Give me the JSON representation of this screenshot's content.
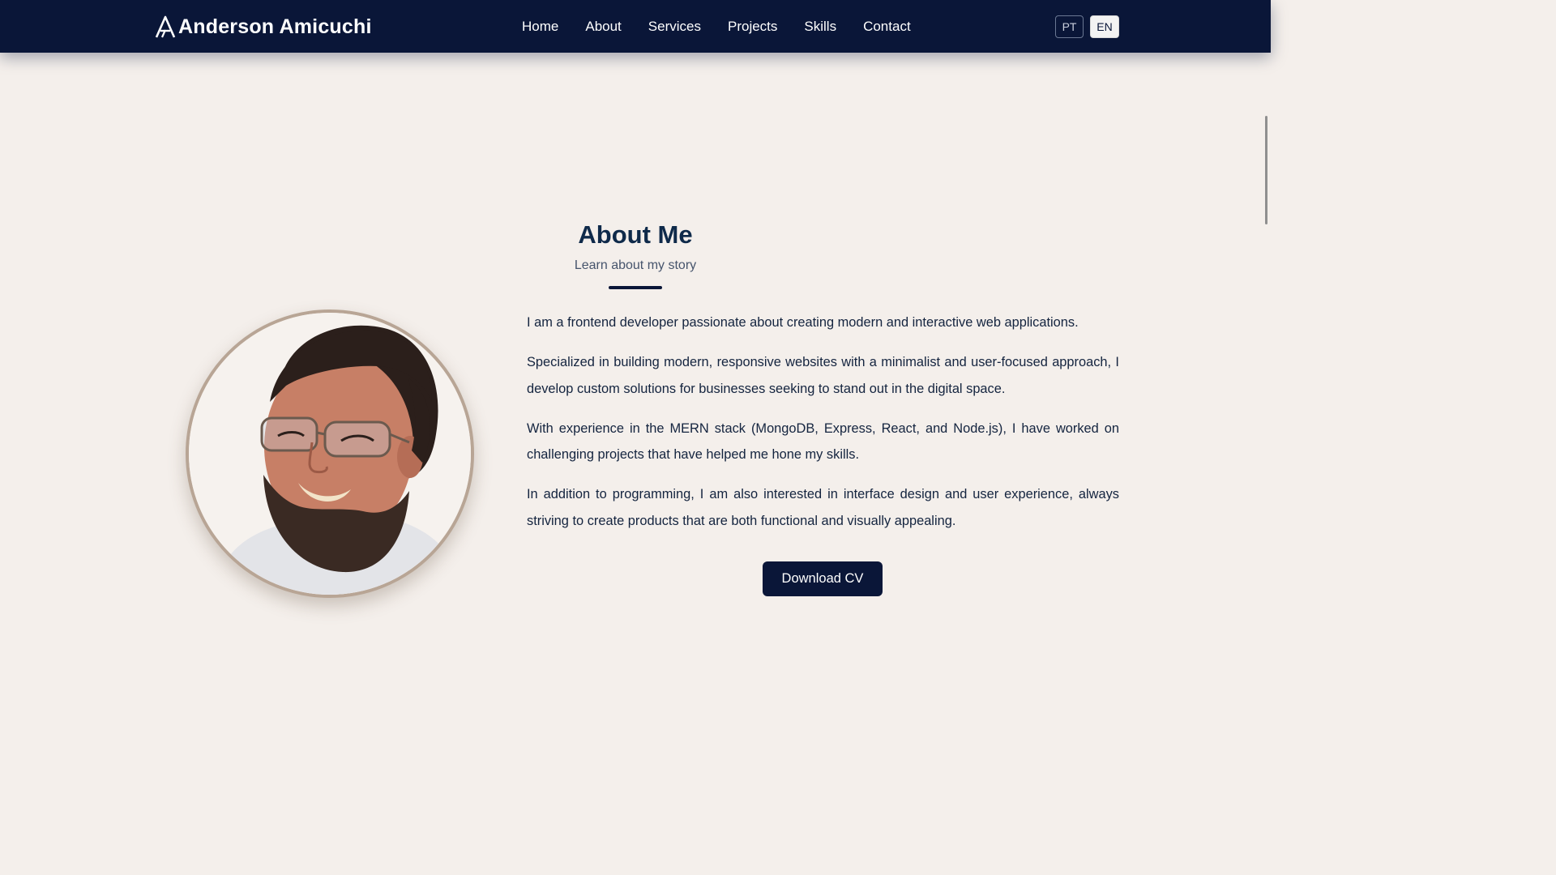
{
  "header": {
    "brand_name": "Anderson Amicuchi",
    "logo_icon": "letter-a-logo-icon",
    "nav": [
      "Home",
      "About",
      "Services",
      "Projects",
      "Skills",
      "Contact"
    ],
    "languages": {
      "pt": "PT",
      "en": "EN"
    },
    "active_language": "EN"
  },
  "about": {
    "title": "About Me",
    "subtitle": "Learn about my story",
    "paragraphs": [
      "I am a frontend developer passionate about creating modern and interactive web applications.",
      "Specialized in building modern, responsive websites with a minimalist and user-focused approach, I develop custom solutions for businesses seeking to stand out in the digital space.",
      "With experience in the MERN stack (MongoDB, Express, React, and Node.js), I have worked on challenging projects that have helped me hone my skills.",
      "In addition to programming, I am also interested in interface design and user experience, always striving to create products that are both functional and visually appealing."
    ],
    "download_label": "Download CV"
  },
  "colors": {
    "navbar": "#0a1638",
    "background": "#f4efeb",
    "heading": "#0f2a4a",
    "avatar_border": "#b8a595",
    "button": "#0a1638"
  }
}
